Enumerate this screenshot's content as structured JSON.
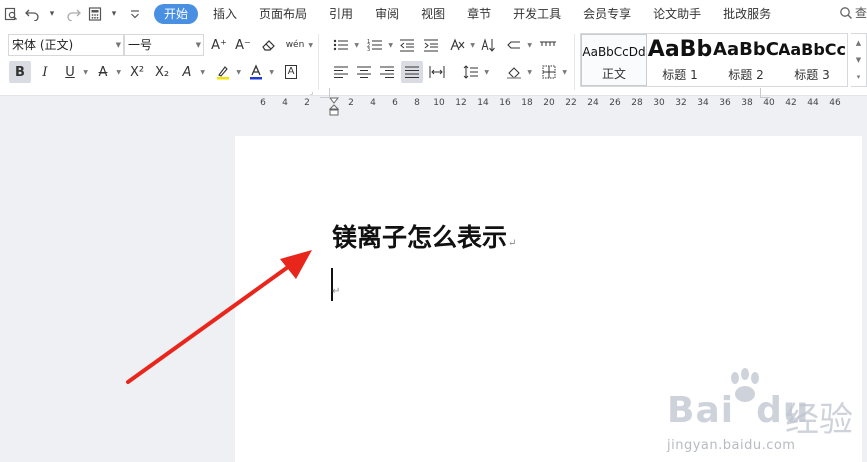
{
  "menubar": {
    "tabs": [
      "开始",
      "插入",
      "页面布局",
      "引用",
      "审阅",
      "视图",
      "章节",
      "开发工具",
      "会员专享",
      "论文助手",
      "批改服务"
    ],
    "active_tab": "开始",
    "search_label": "查",
    "accent_color": "#4a90e2"
  },
  "quick_access": {
    "icons": [
      "preview-icon",
      "undo-icon",
      "redo-icon",
      "calculator-icon",
      "customize-icon"
    ]
  },
  "ribbon": {
    "font_name": "宋体 (正文)",
    "font_size": "一号",
    "increase_font_glyph": "A⁺",
    "decrease_font_glyph": "A⁻",
    "pinyin_glyph": "wén",
    "bold_glyph": "B",
    "italic_glyph": "I",
    "underline_glyph": "U",
    "strikethrough_glyph": "A",
    "superscript_glyph": "X²",
    "subscript_glyph": "X₂",
    "text_effect_glyph": "A",
    "highlight_glyph": "ℓ",
    "font_color_glyph": "A",
    "char_border_glyph": "A",
    "font_color": "#1f3bd6",
    "highlight_color": "#f2e600",
    "styles": [
      {
        "sample": "AaBbCcDd",
        "name": "正文"
      },
      {
        "sample": "AaBb",
        "name": "标题 1"
      },
      {
        "sample": "AaBbC",
        "name": "标题 2"
      },
      {
        "sample": "AaBbCc",
        "name": "标题 3"
      }
    ]
  },
  "ruler": {
    "labels": [
      "6",
      "4",
      "2",
      "2",
      "4",
      "6",
      "8",
      "10",
      "12",
      "14",
      "16",
      "18",
      "20",
      "22",
      "24",
      "26",
      "28",
      "30",
      "32",
      "34",
      "36",
      "38",
      "40",
      "42",
      "44",
      "46"
    ]
  },
  "document": {
    "heading": "镁离子怎么表示",
    "paragraph_mark": "↵"
  },
  "annotation": {
    "arrow_color": "#e8261c"
  },
  "watermark": {
    "brand": "Bai",
    "brand2": "du",
    "product": "经验",
    "url": "jingyan.baidu.com"
  }
}
